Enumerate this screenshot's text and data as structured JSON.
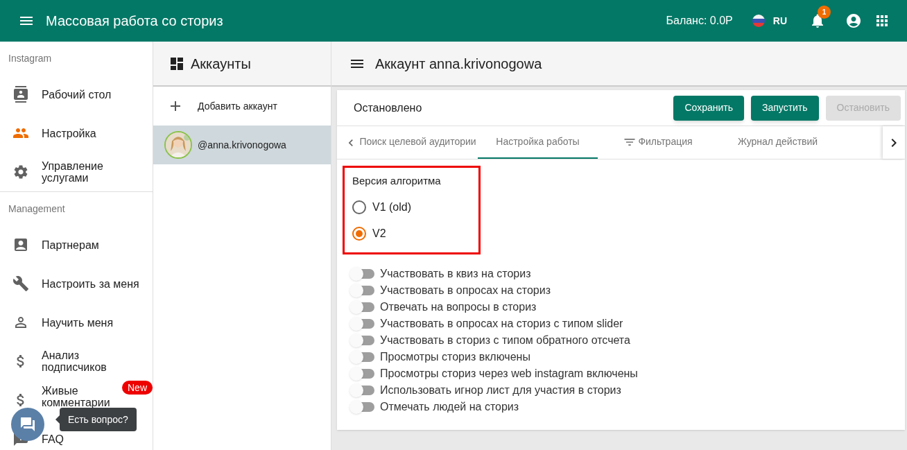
{
  "app_bar": {
    "title": "Массовая работа со сториз",
    "balance": "Баланс: 0.0Р",
    "language": "RU",
    "notification_count": "1"
  },
  "sidebar": {
    "sections": [
      {
        "title": "Instagram",
        "items": [
          {
            "label": "Рабочий стол",
            "selected": false
          },
          {
            "label": "Настройка",
            "selected": true
          },
          {
            "label": "Управление услугами",
            "selected": false
          }
        ]
      },
      {
        "title": "Management",
        "items": [
          {
            "label": "Партнерам",
            "selected": false
          },
          {
            "label": "Настроить за меня",
            "selected": false
          },
          {
            "label": "Научить меня",
            "selected": false
          },
          {
            "label": "Анализ подписчиков",
            "selected": false
          },
          {
            "label": "Живые комментарии",
            "selected": false,
            "badge": "New"
          },
          {
            "label": "FAQ",
            "selected": false
          }
        ]
      }
    ]
  },
  "accounts": {
    "title": "Аккаунты",
    "add_label": "Добавить аккаунт",
    "items": [
      {
        "handle": "@anna.krivonogowa",
        "selected": true
      }
    ]
  },
  "main": {
    "title": "Аккаунт anna.krivonogowa",
    "status": "Остановлено",
    "buttons": [
      {
        "label": "Сохранить",
        "disabled": false
      },
      {
        "label": "Запустить",
        "disabled": false
      },
      {
        "label": "Остановить",
        "disabled": true
      }
    ],
    "tabs": [
      {
        "label": "Поиск целевой аудитории",
        "selected": false
      },
      {
        "label": "Настройка работы",
        "selected": true
      },
      {
        "label": "Фильтрация",
        "selected": false,
        "icon": true
      },
      {
        "label": "Журнал действий",
        "selected": false
      }
    ],
    "algorithm": {
      "title": "Версия алгоритма",
      "options": [
        {
          "label": "V1 (old)",
          "selected": false
        },
        {
          "label": "V2",
          "selected": true
        }
      ]
    },
    "toggles": [
      {
        "label": "Участвовать в квиз на сториз",
        "on": false
      },
      {
        "label": "Участвовать в опросах на сториз",
        "on": false
      },
      {
        "label": "Отвечать на вопросы в сториз",
        "on": false
      },
      {
        "label": "Участвовать в опросах на сториз с типом slider",
        "on": false
      },
      {
        "label": "Участвовать в сториз с типом обратного отсчета",
        "on": false
      },
      {
        "label": "Просмотры сториз включены",
        "on": false
      },
      {
        "label": "Просмотры сториз через web instagram включены",
        "on": false
      },
      {
        "label": "Использовать игнор лист для участия в сториз",
        "on": false
      },
      {
        "label": "Отмечать людей на сториз",
        "on": false
      }
    ]
  },
  "chat": {
    "tooltip": "Есть вопрос?"
  }
}
